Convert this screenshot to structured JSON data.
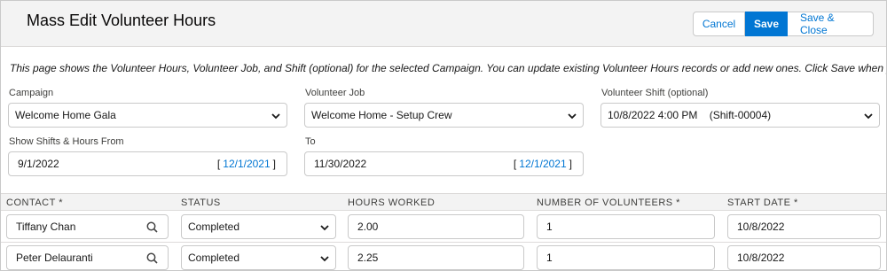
{
  "header": {
    "title": "Mass Edit Volunteer Hours",
    "cancel_label": "Cancel",
    "save_label": "Save",
    "save_close_label": "Save & Close"
  },
  "intro": "This page shows the Volunteer Hours, Volunteer Job, and Shift (optional) for the selected Campaign. You can update existing Volunteer Hours records or add new ones. Click Save when you're done.",
  "filters": {
    "campaign": {
      "label": "Campaign",
      "value": "Welcome Home Gala"
    },
    "job": {
      "label": "Volunteer Job",
      "value": "Welcome Home - Setup Crew"
    },
    "shift": {
      "label": "Volunteer Shift (optional)",
      "value": "10/8/2022 4:00 PM    (Shift-00004)"
    },
    "from": {
      "label": "Show Shifts & Hours From",
      "value": "9/1/2022",
      "today_open": "[",
      "today": "12/1/2021",
      "today_close": "]"
    },
    "to": {
      "label": "To",
      "value": "11/30/2022",
      "today_open": "[",
      "today": "12/1/2021",
      "today_close": "]"
    }
  },
  "grid": {
    "columns": [
      "CONTACT *",
      "STATUS",
      "HOURS WORKED",
      "NUMBER OF VOLUNTEERS *",
      "START DATE *"
    ],
    "rows": [
      {
        "contact": "Tiffany Chan",
        "status": "Completed",
        "hours": "2.00",
        "volunteers": "1",
        "start_date": "10/8/2022"
      },
      {
        "contact": "Peter Delauranti",
        "status": "Completed",
        "hours": "2.25",
        "volunteers": "1",
        "start_date": "10/8/2022"
      }
    ]
  },
  "icons": {
    "select": "chevron-down-icon",
    "lookup": "search-icon"
  },
  "colors": {
    "brand": "#0176d3",
    "header_bg": "#f3f3f3",
    "border": "#c9c9c9"
  }
}
